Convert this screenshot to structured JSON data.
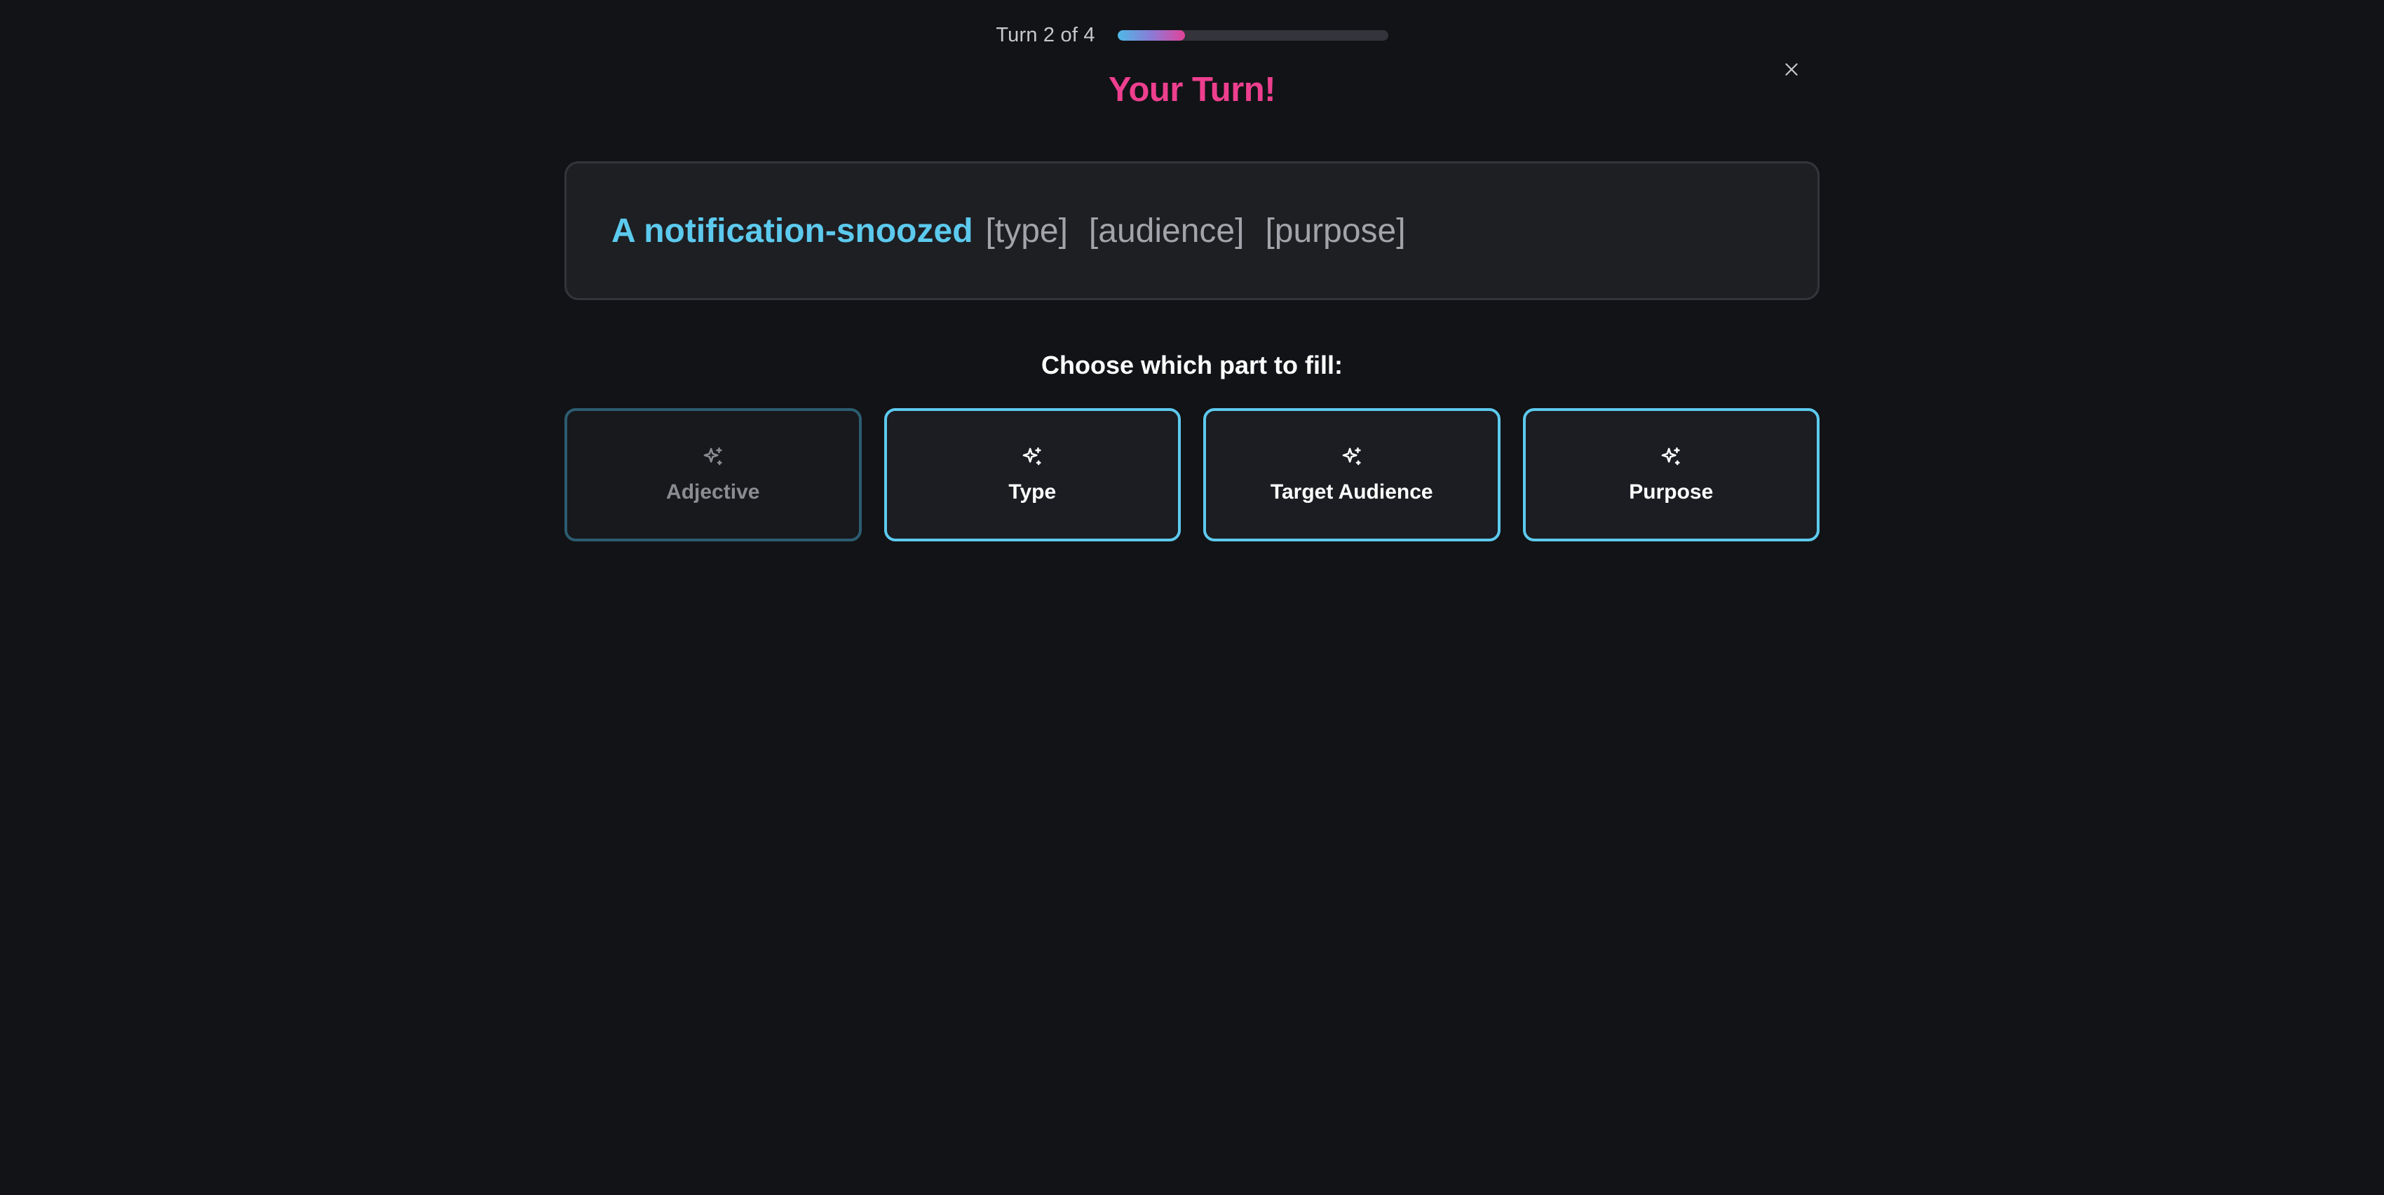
{
  "progress": {
    "turn_text": "Turn 2 of 4",
    "fraction": 0.25
  },
  "title": "Your Turn!",
  "prompt": {
    "filled": "A notification-snoozed",
    "slots": [
      "[type]",
      "[audience]",
      "[purpose]"
    ]
  },
  "choose_label": "Choose which part to fill:",
  "options": [
    {
      "label": "Adjective",
      "icon": "sparkles-icon",
      "disabled": true
    },
    {
      "label": "Type",
      "icon": "sparkles-icon",
      "disabled": false
    },
    {
      "label": "Target Audience",
      "icon": "sparkles-icon",
      "disabled": false
    },
    {
      "label": "Purpose",
      "icon": "sparkles-icon",
      "disabled": false
    }
  ],
  "colors": {
    "background": "#121316",
    "accent_pink": "#ee3f8f",
    "accent_cyan": "#5ccaee",
    "slot_gray": "#a2a4aa"
  }
}
